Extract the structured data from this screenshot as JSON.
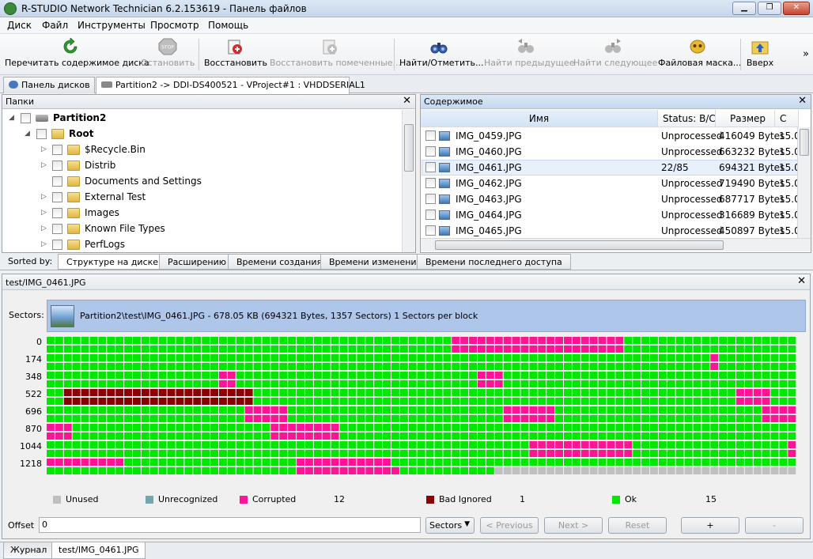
{
  "window": {
    "title": "R-STUDIO Network Technician 6.2.153619 - Панель файлов"
  },
  "menu": [
    "Диск",
    "Файл",
    "Инструменты",
    "Просмотр",
    "Помощь"
  ],
  "toolbar": {
    "rescan": "Перечитать содержимое диска",
    "stop": "Остановить",
    "recover": "Восстановить",
    "recover_marked": "Восстановить помеченные...",
    "find_mark": "Найти/Отметить...",
    "find_prev": "Найти предыдущее",
    "find_next": "Найти следующее",
    "file_mask": "Файловая маска...",
    "up": "Вверх",
    "more": "»"
  },
  "tabs": {
    "disks": "Панель дисков",
    "partition": "Partition2 -> DDI-DS400521 - VProject#1 : VHDDSERIAL1"
  },
  "folders": {
    "header": "Папки",
    "close": "✕",
    "root_partition": "Partition2",
    "root": "Root",
    "items": [
      "$Recycle.Bin",
      "Distrib",
      "Documents and Settings",
      "External Test",
      "Images",
      "Known File Types",
      "PerfLogs"
    ]
  },
  "contents": {
    "header": "Содержимое",
    "close": "✕",
    "columns": [
      "Имя",
      "Status: B/C",
      "Размер",
      "С"
    ],
    "rows": [
      {
        "name": "IMG_0459.JPG",
        "status": "Unprocessed",
        "size": "416049 Bytes",
        "date": "15.0"
      },
      {
        "name": "IMG_0460.JPG",
        "status": "Unprocessed",
        "size": "663232 Bytes",
        "date": "15.0"
      },
      {
        "name": "IMG_0461.JPG",
        "status": "22/85",
        "size": "694321 Bytes",
        "date": "15.0"
      },
      {
        "name": "IMG_0462.JPG",
        "status": "Unprocessed",
        "size": "719490 Bytes",
        "date": "15.0"
      },
      {
        "name": "IMG_0463.JPG",
        "status": "Unprocessed",
        "size": "687717 Bytes",
        "date": "15.0"
      },
      {
        "name": "IMG_0464.JPG",
        "status": "Unprocessed",
        "size": "316689 Bytes",
        "date": "15.0"
      },
      {
        "name": "IMG_0465.JPG",
        "status": "Unprocessed",
        "size": "450897 Bytes",
        "date": "15.0"
      }
    ]
  },
  "sort": {
    "label": "Sorted by:",
    "tabs": [
      "Структуре на диске",
      "Расширению",
      "Времени создания",
      "Времени изменения",
      "Времени последнего доступа"
    ]
  },
  "sector_map": {
    "path": "test/IMG_0461.JPG",
    "close": "✕",
    "sectors_label": "Sectors:",
    "info": "Partition2\\test\\IMG_0461.JPG - 678.05 KB (694321 Bytes, 1357 Sectors) 1 Sectors per block",
    "row_labels": [
      "0",
      "174",
      "348",
      "522",
      "696",
      "870",
      "1044",
      "1218"
    ],
    "colors": {
      "ok": "#00e800",
      "corrupted": "#ff1493",
      "bad_ignored": "#8b0000",
      "unused": "#c0c0c0",
      "unrecognized": "#74a6b0"
    },
    "legend": [
      {
        "label": "Unused",
        "color": "#c0c0c0",
        "count": ""
      },
      {
        "label": "Unrecognized",
        "color": "#74a6b0",
        "count": ""
      },
      {
        "label": "Corrupted",
        "color": "#ff1493",
        "count": "12"
      },
      {
        "label": "Bad Ignored",
        "color": "#8b0000",
        "count": "1"
      },
      {
        "label": "Ok",
        "color": "#00e800",
        "count": "15"
      }
    ],
    "offset_label": "Offset",
    "offset_value": "0",
    "sectors_dropdown": "Sectors",
    "prev": "< Previous",
    "next": "Next >",
    "reset": "Reset",
    "plus": "+",
    "minus": "-"
  },
  "bottom_tabs": [
    "Журнал",
    "test/IMG_0461.JPG"
  ]
}
